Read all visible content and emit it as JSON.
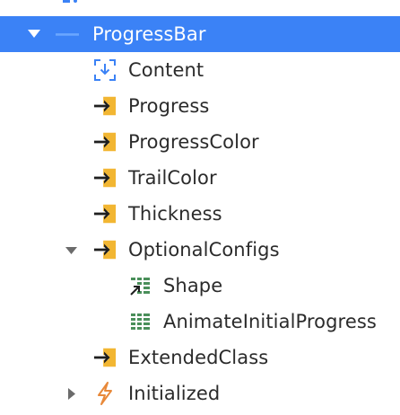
{
  "tree": {
    "items": [
      {
        "label": "ProgressBar",
        "kind": "component",
        "expanded": true,
        "selected": true
      },
      {
        "label": "Content",
        "kind": "content-slot"
      },
      {
        "label": "Progress",
        "kind": "input-property"
      },
      {
        "label": "ProgressColor",
        "kind": "input-property"
      },
      {
        "label": "TrailColor",
        "kind": "input-property"
      },
      {
        "label": "Thickness",
        "kind": "input-property"
      },
      {
        "label": "OptionalConfigs",
        "kind": "input-property",
        "expanded": true
      },
      {
        "label": "Shape",
        "kind": "structure-attribute"
      },
      {
        "label": "AnimateInitialProgress",
        "kind": "structure-attribute"
      },
      {
        "label": "ExtendedClass",
        "kind": "input-property"
      },
      {
        "label": "Initialized",
        "kind": "event",
        "expanded": false
      }
    ]
  },
  "colors": {
    "selection": "#3b82f6",
    "input_icon_yellow": "#f2b632",
    "input_icon_arrow": "#1f1f1f",
    "structure_green": "#4a8f5a",
    "event_orange": "#e8893a",
    "content_blue": "#3b82f6",
    "text": "#2b2b2b"
  },
  "icons": {
    "expand": "triangle-down",
    "collapse": "triangle-right",
    "input": "arrow-into-box-icon",
    "content": "placeholder-download-icon",
    "structure": "table-grid-icon",
    "event": "lightning-bolt-icon"
  }
}
